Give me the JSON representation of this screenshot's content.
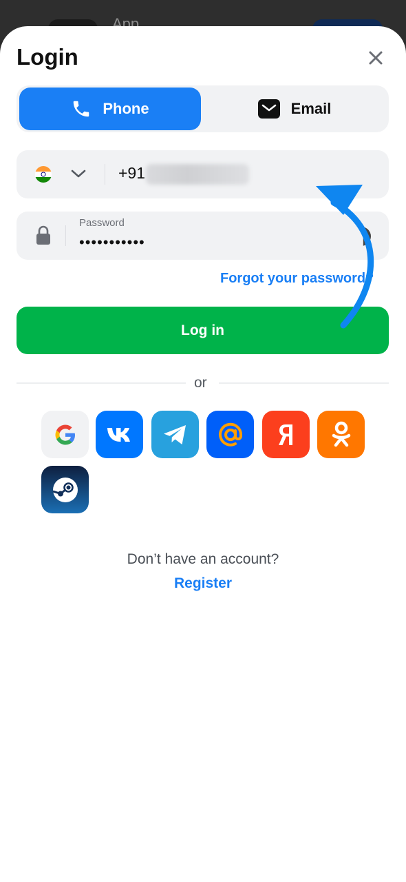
{
  "backdrop": {
    "title": "App"
  },
  "modal": {
    "title": "Login",
    "close_icon": "close-icon"
  },
  "tabs": [
    {
      "label": "Phone",
      "icon": "phone-icon",
      "active": true
    },
    {
      "label": "Email",
      "icon": "mail-icon",
      "active": false
    }
  ],
  "phone": {
    "country_flag": "india-flag-icon",
    "code": "+91"
  },
  "password": {
    "label": "Password",
    "value": "•••••••••••"
  },
  "forgot_label": "Forgot your password?",
  "login_label": "Log in",
  "or_label": "or",
  "social": [
    {
      "name": "Google",
      "icon": "google-icon",
      "letter": "G",
      "color": "#f1f2f4"
    },
    {
      "name": "VK",
      "icon": "vk-icon",
      "letter": "VK",
      "color": "#0077ff"
    },
    {
      "name": "Telegram",
      "icon": "telegram-icon",
      "letter": "",
      "color": "#28a1de"
    },
    {
      "name": "Mail.ru",
      "icon": "mail-ru-icon",
      "letter": "@",
      "color": "#005ff9"
    },
    {
      "name": "Yandex",
      "icon": "yandex-icon",
      "letter": "Я",
      "color": "#fc3f1d"
    },
    {
      "name": "Odnoklassniki",
      "icon": "ok-icon",
      "letter": "",
      "color": "#ff7700"
    },
    {
      "name": "Steam",
      "icon": "steam-icon",
      "letter": "",
      "color": "#0e1f3f"
    }
  ],
  "footer": {
    "no_account": "Don’t have an account?",
    "register_label": "Register"
  },
  "colors": {
    "accent": "#1a7ff5",
    "success": "#00b34a",
    "field_bg": "#f1f2f4"
  }
}
